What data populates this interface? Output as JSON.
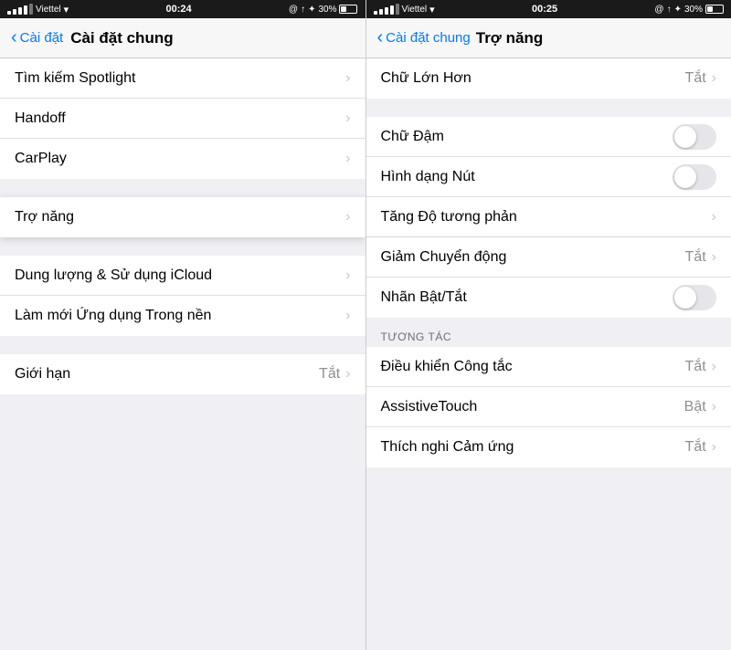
{
  "left": {
    "statusBar": {
      "carrier": "Viettel",
      "time": "00:24",
      "icons": "@ ↑ ♦ ¥ 30%"
    },
    "nav": {
      "backLabel": "Cài đặt",
      "title": "Cài đặt chung"
    },
    "items": [
      {
        "id": "tim-kiem",
        "label": "Tìm kiếm Spotlight",
        "value": "",
        "type": "nav"
      },
      {
        "id": "handoff",
        "label": "Handoff",
        "value": "",
        "type": "nav"
      },
      {
        "id": "carplay",
        "label": "CarPlay",
        "value": "",
        "type": "nav"
      },
      {
        "id": "tro-nang",
        "label": "Trợ năng",
        "value": "",
        "type": "nav",
        "highlighted": true
      },
      {
        "id": "dung-luong",
        "label": "Dung lượng & Sử dụng iCloud",
        "value": "",
        "type": "nav"
      },
      {
        "id": "lam-moi",
        "label": "Làm mới Ứng dụng Trong nền",
        "value": "",
        "type": "nav"
      },
      {
        "id": "gioi-han",
        "label": "Giới hạn",
        "value": "Tắt",
        "type": "nav"
      }
    ]
  },
  "right": {
    "statusBar": {
      "carrier": "Viettel",
      "time": "00:25",
      "icons": "@ ↑ ♦ ¥ 30%"
    },
    "nav": {
      "backLabel": "Cài đặt chung",
      "title": "Trợ năng"
    },
    "topItem": {
      "id": "chu-lon-hon",
      "label": "Chữ Lớn Hơn",
      "value": "Tắt",
      "type": "nav"
    },
    "items": [
      {
        "id": "chu-dam",
        "label": "Chữ Đậm",
        "value": "",
        "type": "toggle",
        "toggleState": "off"
      },
      {
        "id": "hinh-dang-nut",
        "label": "Hình dạng Nút",
        "value": "",
        "type": "toggle",
        "toggleState": "off"
      },
      {
        "id": "tang-do-tuong-phan",
        "label": "Tăng Độ tương phản",
        "value": "",
        "type": "nav"
      },
      {
        "id": "giam-chuyen-dong",
        "label": "Giảm Chuyển động",
        "value": "Tắt",
        "type": "nav",
        "highlighted": true
      },
      {
        "id": "nhan-bat-tat",
        "label": "Nhãn Bật/Tắt",
        "value": "",
        "type": "toggle",
        "toggleState": "off"
      }
    ],
    "sectionHeader": "TƯƠNG TÁC",
    "sectionItems": [
      {
        "id": "dieu-khien",
        "label": "Điều khiển Công tắc",
        "value": "Tắt",
        "type": "nav"
      },
      {
        "id": "assistive-touch",
        "label": "AssistiveTouch",
        "value": "Bật",
        "type": "nav"
      },
      {
        "id": "thich-nghi",
        "label": "Thích nghi Cảm ứng",
        "value": "Tắt",
        "type": "nav"
      }
    ]
  }
}
